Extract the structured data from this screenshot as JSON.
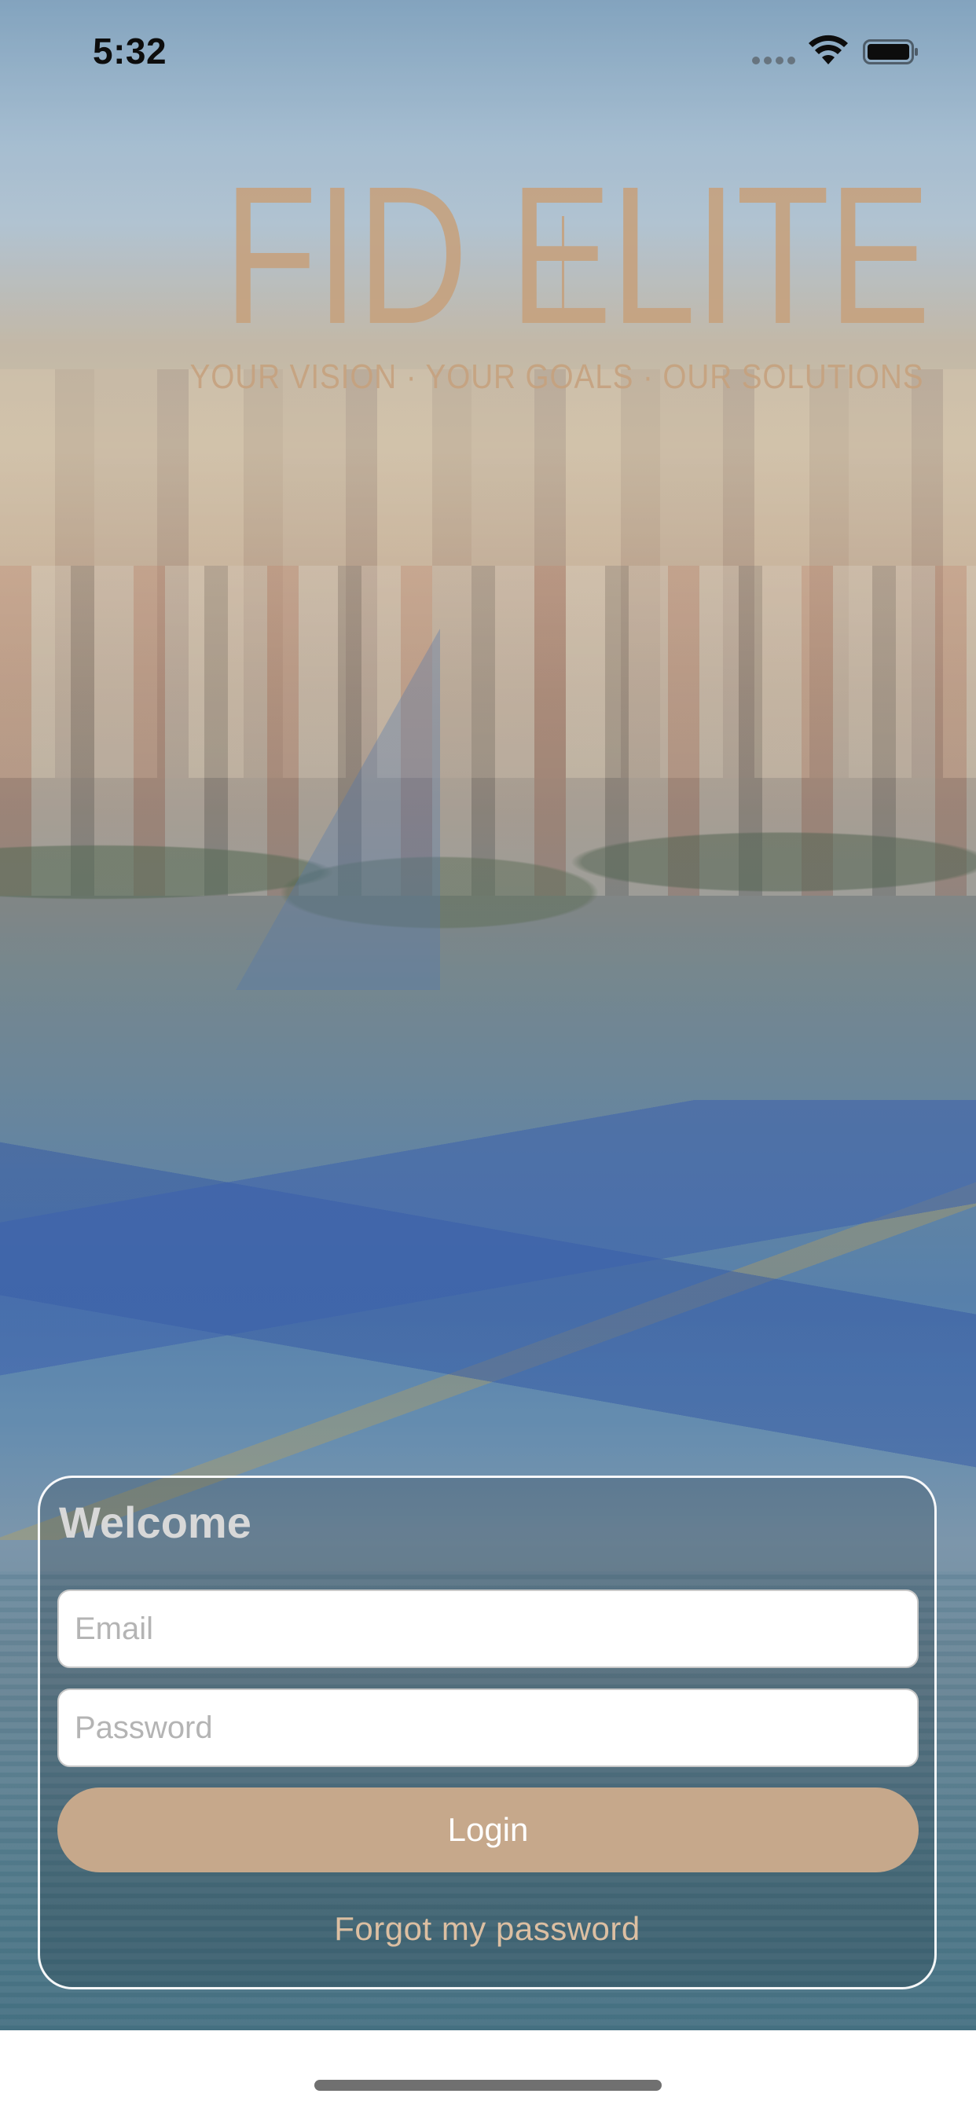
{
  "status_bar": {
    "time": "5:32"
  },
  "logo": {
    "brand_left": "FID",
    "brand_right": "ELITE",
    "tagline": "YOUR VISION · YOUR GOALS · OUR SOLUTIONS",
    "color": "#c6a27f"
  },
  "login": {
    "title": "Welcome",
    "email_placeholder": "Email",
    "password_placeholder": "Password",
    "login_label": "Login",
    "forgot_label": "Forgot my password",
    "button_color": "#c6a88b"
  }
}
